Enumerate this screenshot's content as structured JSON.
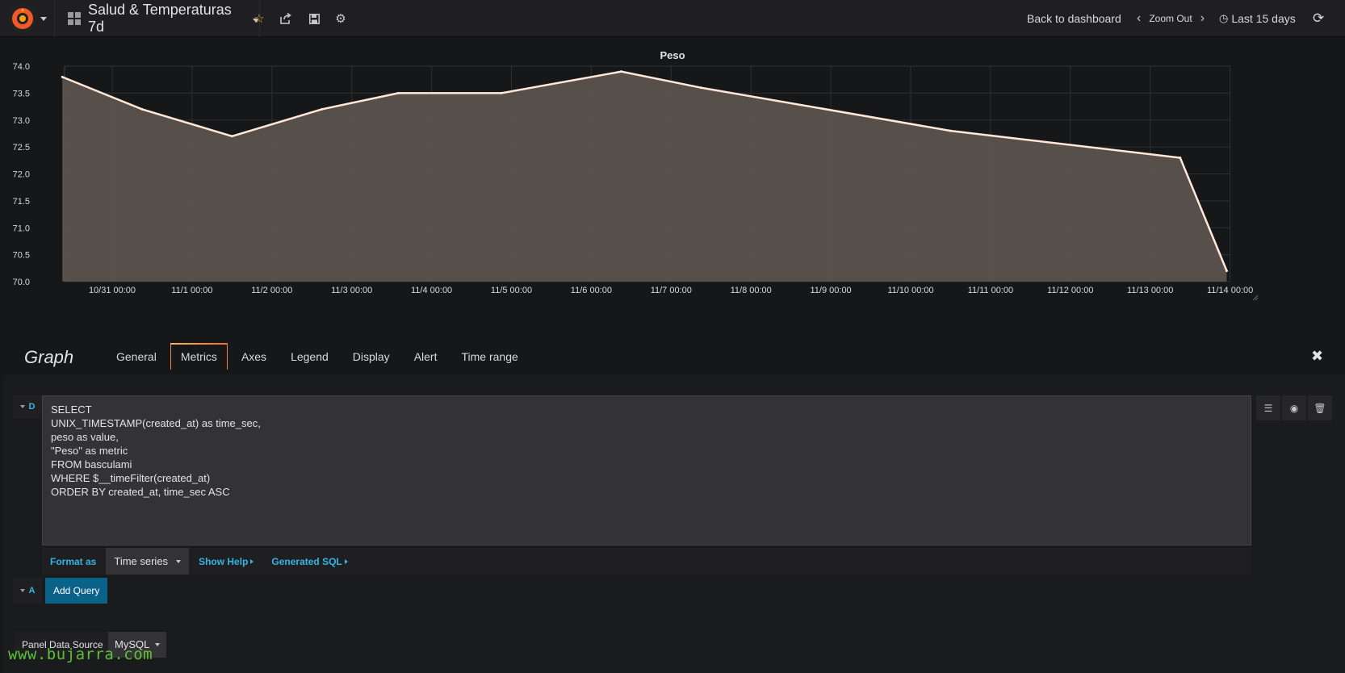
{
  "navbar": {
    "dashboard_title": "Salud & Temperaturas 7d",
    "back_label": "Back to dashboard",
    "zoom_label": "Zoom Out",
    "range_label": "Last 15 days"
  },
  "panel": {
    "title": "Peso"
  },
  "chart_data": {
    "type": "area",
    "title": "Peso",
    "x": [
      "10/30 09:00",
      "10/31 09:00",
      "11/1 12:00",
      "11/2 15:00",
      "11/3 14:00",
      "11/4 21:00",
      "11/6 09:00",
      "11/7 09:00",
      "11/10 12:00",
      "11/13 09:00",
      "11/13 23:00"
    ],
    "series": [
      {
        "values": [
          73.8,
          73.2,
          72.7,
          73.2,
          73.5,
          73.5,
          73.9,
          73.6,
          72.8,
          72.3,
          70.2
        ],
        "color": "#ffe8d8"
      }
    ],
    "x_tick_labels": [
      "10/31 00:00",
      "11/1 00:00",
      "11/2 00:00",
      "11/3 00:00",
      "11/4 00:00",
      "11/5 00:00",
      "11/6 00:00",
      "11/7 00:00",
      "11/8 00:00",
      "11/9 00:00",
      "11/10 00:00",
      "11/11 00:00",
      "11/12 00:00",
      "11/13 00:00",
      "11/14 00:00"
    ],
    "y_tick_labels": [
      "74.0",
      "73.5",
      "73.0",
      "72.5",
      "72.0",
      "71.5",
      "71.0",
      "70.5",
      "70.0"
    ],
    "ylim": [
      70.0,
      74.0
    ],
    "grid": true
  },
  "editor": {
    "title": "Graph",
    "tabs": [
      "General",
      "Metrics",
      "Axes",
      "Legend",
      "Display",
      "Alert",
      "Time range"
    ],
    "active_tab": "Metrics",
    "query": {
      "ref": "D",
      "sql": "SELECT\nUNIX_TIMESTAMP(created_at) as time_sec,\npeso as value,\n\"Peso\" as metric\nFROM basculami\nWHERE $__timeFilter(created_at)\nORDER BY created_at, time_sec ASC",
      "format_label": "Format as",
      "format_value": "Time series",
      "show_help": "Show Help",
      "generated_sql": "Generated SQL"
    },
    "add_row_ref": "A",
    "add_query": "Add Query",
    "datasource_label": "Panel Data Source",
    "datasource_value": "MySQL"
  },
  "watermark": "www.bujarra.com",
  "colors": {
    "accent": "#33b5e5",
    "tab_active": "#f0833a",
    "series_fill": "#5b524d"
  }
}
